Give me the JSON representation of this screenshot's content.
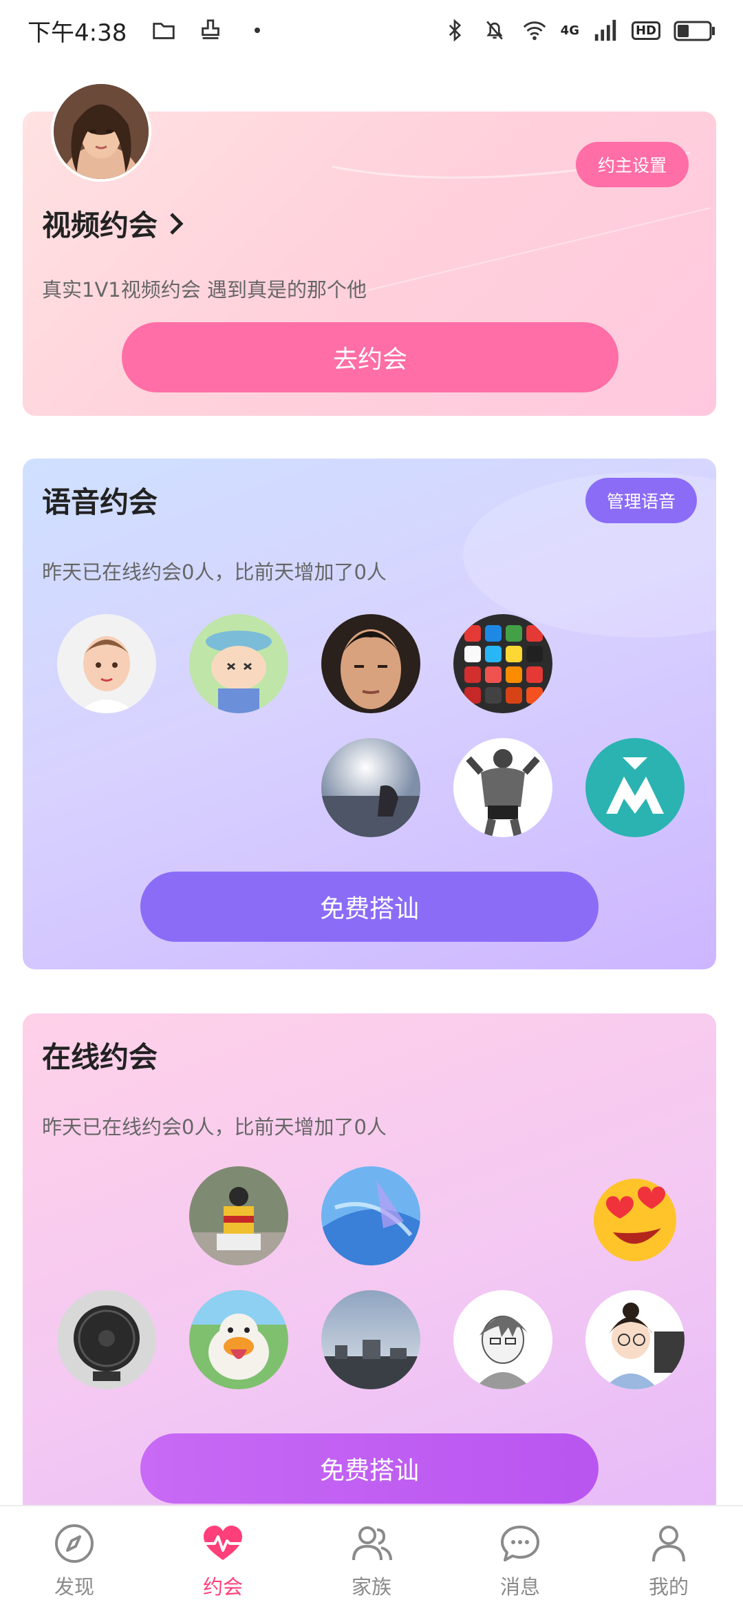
{
  "status_bar": {
    "time": "下午4:38",
    "network": "4G",
    "hd": "HD"
  },
  "video_card": {
    "title": "视频约会",
    "subtitle": "真实1V1视频约会 遇到真是的那个他",
    "settings_button": "约主设置",
    "cta": "去约会"
  },
  "voice_card": {
    "title": "语音约会",
    "manage_button": "管理语音",
    "stats": "昨天已在线约会0人，比前天增加了0人",
    "cta": "免费搭讪"
  },
  "online_card": {
    "title": "在线约会",
    "stats": "昨天已在线约会0人，比前天增加了0人",
    "cta": "免费搭讪"
  },
  "tabs": [
    {
      "label": "发现",
      "icon": "compass-icon"
    },
    {
      "label": "约会",
      "icon": "heart-pulse-icon"
    },
    {
      "label": "家族",
      "icon": "people-icon"
    },
    {
      "label": "消息",
      "icon": "chat-bubble-icon"
    },
    {
      "label": "我的",
      "icon": "person-icon"
    }
  ],
  "colors": {
    "video_accent": "#ff6ea6",
    "voice_accent": "#8b6cf7",
    "online_accent": "#c25af1",
    "active_tab": "#ff3f7a"
  }
}
